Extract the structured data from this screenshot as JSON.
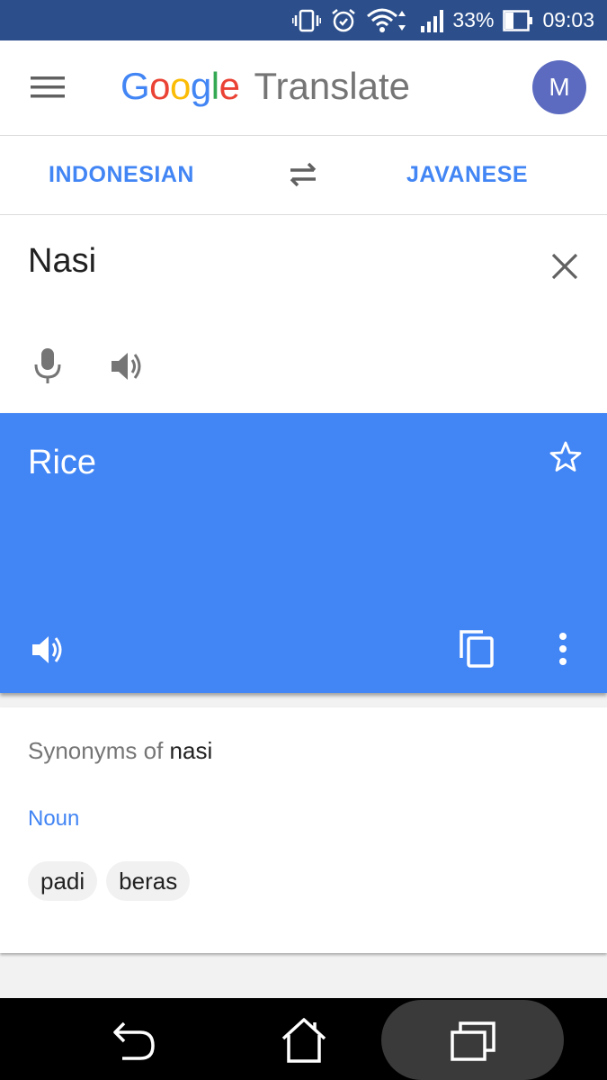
{
  "status_bar": {
    "battery": "33%",
    "time": "09:03",
    "icons": [
      "vibrate-icon",
      "alarm-icon",
      "wifi-icon",
      "signal-icon",
      "battery-icon"
    ]
  },
  "app_bar": {
    "menu_icon": "menu-icon",
    "logo": {
      "letters": [
        "G",
        "o",
        "o",
        "g",
        "l",
        "e"
      ],
      "colors": [
        "#4285f4",
        "#ea4335",
        "#fbbc05",
        "#4285f4",
        "#34a853",
        "#ea4335"
      ],
      "product": "Translate"
    },
    "avatar_initial": "M"
  },
  "languages": {
    "source": "INDONESIAN",
    "target": "JAVANESE",
    "swap_icon": "swap-icon"
  },
  "input": {
    "text": "Nasi",
    "icons": [
      "close-icon",
      "mic-icon",
      "speaker-icon"
    ]
  },
  "result": {
    "text": "Rice",
    "icons": [
      "star-icon",
      "speaker-icon",
      "copy-icon",
      "more-vert-icon"
    ]
  },
  "synonyms": {
    "title_prefix": "Synonyms of",
    "word": "nasi",
    "part_of_speech": "Noun",
    "items": [
      "padi",
      "beras"
    ]
  },
  "nav_bar": {
    "icons": [
      "back-icon",
      "home-icon",
      "recent-apps-icon"
    ]
  },
  "colors": {
    "accent": "#4285f4",
    "status_bar": "#2c4f8c",
    "avatar": "#5c6bc0"
  }
}
